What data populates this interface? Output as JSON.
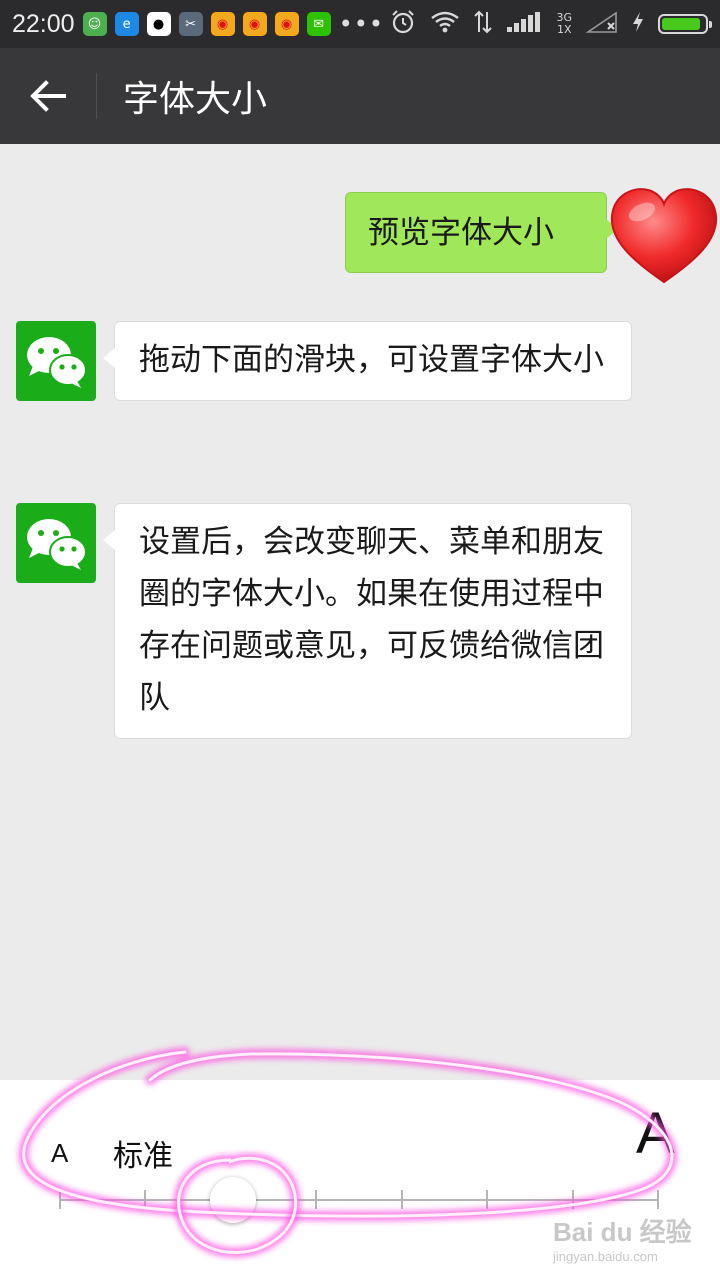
{
  "status_bar": {
    "time": "22:00",
    "apps": [
      {
        "icon": "android-face-icon",
        "color": "#4caf50",
        "glyph": "☺"
      },
      {
        "icon": "browser-icon",
        "color": "#1e88e5",
        "glyph": "e"
      },
      {
        "icon": "qq-icon",
        "color": "#ffffff",
        "glyph": "🐧"
      },
      {
        "icon": "scissors-icon",
        "color": "#5a6a7a",
        "glyph": "✂"
      },
      {
        "icon": "weibo-icon",
        "color": "#f4a81d",
        "glyph": "◉"
      },
      {
        "icon": "weibo-icon",
        "color": "#f4a81d",
        "glyph": "◉"
      },
      {
        "icon": "weibo-icon",
        "color": "#f4a81d",
        "glyph": "◉"
      },
      {
        "icon": "wechat-icon",
        "color": "#2dc100",
        "glyph": "✉"
      }
    ],
    "more": "•••",
    "network_type": "3G",
    "network_sub": "1X",
    "battery_level": 0.9,
    "battery_color": "#48c91e"
  },
  "header": {
    "title": "字体大小"
  },
  "chat": {
    "preview_message": "预览字体大小",
    "messages": [
      {
        "text": "拖动下面的滑块，可设置字体大小"
      },
      {
        "text": "设置后，会改变聊天、菜单和朋友圈的字体大小。如果在使用过程中存在问题或意见，可反馈给微信团队"
      }
    ]
  },
  "font_size_panel": {
    "small_label": "A",
    "large_label": "A",
    "current_level_label": "标准",
    "level_count": 8,
    "current_level_index": 2
  },
  "watermark": {
    "main": "Bai du 经验",
    "sub": "jingyan.baidu.com"
  },
  "colors": {
    "outgoing_bubble": "#a0e75a",
    "wechat_green": "#1aad19",
    "highlight": "#ff4fe0"
  }
}
